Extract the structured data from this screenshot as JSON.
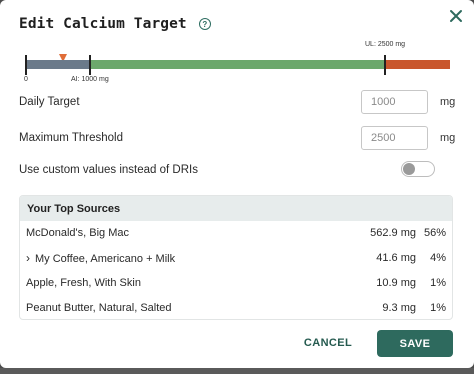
{
  "dialog": {
    "title": "Edit Calcium Target",
    "help_icon": "question-circle-icon",
    "close_icon": "close-x-icon"
  },
  "range_bar": {
    "zero_label": "0",
    "ai_label": "AI: 1000 mg",
    "ul_label": "UL: 2500 mg",
    "current_value_mg": 562.9,
    "colors": {
      "below": "#6b7a8a",
      "target": "#6ca86c",
      "over": "#c9572d",
      "marker": "#e06d38"
    }
  },
  "form": {
    "daily_target": {
      "label": "Daily Target",
      "placeholder": "1000",
      "unit": "mg"
    },
    "max_threshold": {
      "label": "Maximum Threshold",
      "placeholder": "2500",
      "unit": "mg"
    },
    "custom_toggle": {
      "label": "Use custom values instead of DRIs",
      "on": false
    }
  },
  "sources": {
    "header": "Your Top Sources",
    "rows": [
      {
        "name": "McDonald's, Big Mac",
        "amount": "562.9 mg",
        "percent": "56%",
        "expandable": false
      },
      {
        "name": "My Coffee, Americano + Milk",
        "amount": "41.6 mg",
        "percent": "4%",
        "expandable": true,
        "chevron": "›"
      },
      {
        "name": "Apple, Fresh, With Skin",
        "amount": "10.9 mg",
        "percent": "1%",
        "expandable": false
      },
      {
        "name": "Peanut Butter, Natural, Salted",
        "amount": "9.3 mg",
        "percent": "1%",
        "expandable": false
      }
    ]
  },
  "actions": {
    "cancel_label": "CANCEL",
    "save_label": "SAVE",
    "accent": "#2e6a5e"
  }
}
